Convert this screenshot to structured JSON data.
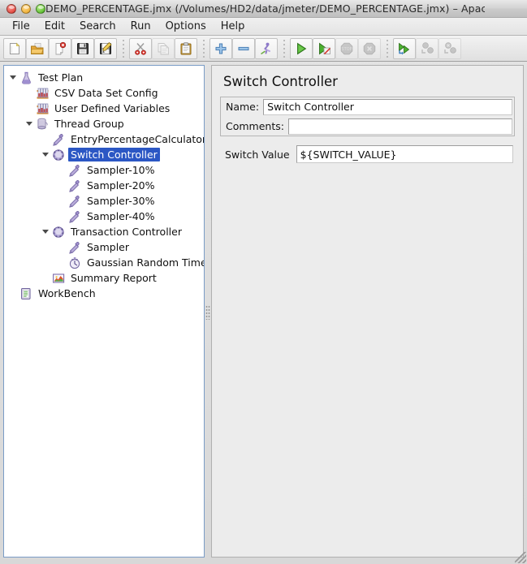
{
  "window": {
    "title": "DEMO_PERCENTAGE.jmx (/Volumes/HD2/data/jmeter/DEMO_PERCENTAGE.jmx) – Apac...",
    "controls": [
      "close",
      "minimize",
      "maximize"
    ],
    "accent_selection_color": "#2b57c4",
    "panel_background": "#ececec",
    "tree_background": "#ffffff"
  },
  "menubar": {
    "items": [
      {
        "label": "File"
      },
      {
        "label": "Edit"
      },
      {
        "label": "Search"
      },
      {
        "label": "Run"
      },
      {
        "label": "Options"
      },
      {
        "label": "Help"
      }
    ]
  },
  "toolbar": {
    "groups": [
      {
        "buttons": [
          {
            "icon": "new-document-icon",
            "tooltip": "New",
            "enabled": true
          },
          {
            "icon": "open-folder-icon",
            "tooltip": "Open",
            "enabled": true
          },
          {
            "icon": "close-document-icon",
            "tooltip": "Close",
            "enabled": true
          },
          {
            "icon": "save-floppy-icon",
            "tooltip": "Save",
            "enabled": true
          },
          {
            "icon": "save-as-icon",
            "tooltip": "Save As",
            "enabled": true
          }
        ]
      },
      {
        "buttons": [
          {
            "icon": "cut-scissors-icon",
            "tooltip": "Cut",
            "enabled": true
          },
          {
            "icon": "copy-pages-icon",
            "tooltip": "Copy",
            "enabled": false
          },
          {
            "icon": "paste-clipboard-icon",
            "tooltip": "Paste",
            "enabled": true
          }
        ]
      },
      {
        "buttons": [
          {
            "icon": "expand-plus-icon",
            "tooltip": "Expand All",
            "enabled": true
          },
          {
            "icon": "collapse-minus-icon",
            "tooltip": "Collapse All",
            "enabled": true
          },
          {
            "icon": "toggle-runner-icon",
            "tooltip": "Toggle",
            "enabled": true
          }
        ]
      },
      {
        "buttons": [
          {
            "icon": "start-play-icon",
            "tooltip": "Start",
            "enabled": true
          },
          {
            "icon": "start-no-timers-icon",
            "tooltip": "Start no pauses",
            "enabled": true
          },
          {
            "icon": "stop-octagon-icon",
            "tooltip": "Stop",
            "enabled": false
          },
          {
            "icon": "shutdown-octagon-icon",
            "tooltip": "Shutdown",
            "enabled": false
          }
        ]
      },
      {
        "buttons": [
          {
            "icon": "remote-start-all-icon",
            "tooltip": "Remote Start All",
            "enabled": true
          },
          {
            "icon": "remote-stop-all-icon",
            "tooltip": "Remote Stop All",
            "enabled": false
          },
          {
            "icon": "remote-shutdown-all-icon",
            "tooltip": "Remote Shutdown All",
            "enabled": false
          }
        ]
      }
    ]
  },
  "tree": {
    "nodes": [
      {
        "label": "Test Plan",
        "indent": 0,
        "twisty": "open",
        "icon": "test-plan-flask-icon",
        "selected": false
      },
      {
        "label": "CSV Data Set Config",
        "indent": 1,
        "twisty": "none",
        "icon": "config-element-rack-icon",
        "selected": false
      },
      {
        "label": "User Defined Variables",
        "indent": 1,
        "twisty": "none",
        "icon": "config-element-rack-icon",
        "selected": false
      },
      {
        "label": "Thread Group",
        "indent": 1,
        "twisty": "open",
        "icon": "thread-group-spool-icon",
        "selected": false
      },
      {
        "label": "EntryPercentageCalculator",
        "indent": 2,
        "twisty": "none",
        "icon": "sampler-pipette-icon",
        "selected": false
      },
      {
        "label": "Switch Controller",
        "indent": 2,
        "twisty": "open",
        "icon": "controller-disc-icon",
        "selected": true
      },
      {
        "label": "Sampler-10%",
        "indent": 3,
        "twisty": "none",
        "icon": "sampler-pipette-icon",
        "selected": false
      },
      {
        "label": "Sampler-20%",
        "indent": 3,
        "twisty": "none",
        "icon": "sampler-pipette-icon",
        "selected": false
      },
      {
        "label": "Sampler-30%",
        "indent": 3,
        "twisty": "none",
        "icon": "sampler-pipette-icon",
        "selected": false
      },
      {
        "label": "Sampler-40%",
        "indent": 3,
        "twisty": "none",
        "icon": "sampler-pipette-icon",
        "selected": false
      },
      {
        "label": "Transaction Controller",
        "indent": 2,
        "twisty": "open",
        "icon": "controller-disc-icon",
        "selected": false
      },
      {
        "label": "Sampler",
        "indent": 3,
        "twisty": "none",
        "icon": "sampler-pipette-icon",
        "selected": false
      },
      {
        "label": "Gaussian Random Timer",
        "indent": 3,
        "twisty": "none",
        "icon": "timer-clock-icon",
        "selected": false
      },
      {
        "label": "Summary Report",
        "indent": 2,
        "twisty": "none",
        "icon": "summary-report-icon",
        "selected": false
      },
      {
        "label": "WorkBench",
        "indent": 0,
        "twisty": "none",
        "icon": "workbench-clipboard-icon",
        "selected": false
      }
    ]
  },
  "editor": {
    "title": "Switch Controller",
    "fields": [
      {
        "label": "Name:",
        "value": "Switch Controller"
      },
      {
        "label": "Comments:",
        "value": ""
      }
    ],
    "switch_value": {
      "label": "Switch Value",
      "value": "${SWITCH_VALUE}"
    }
  }
}
